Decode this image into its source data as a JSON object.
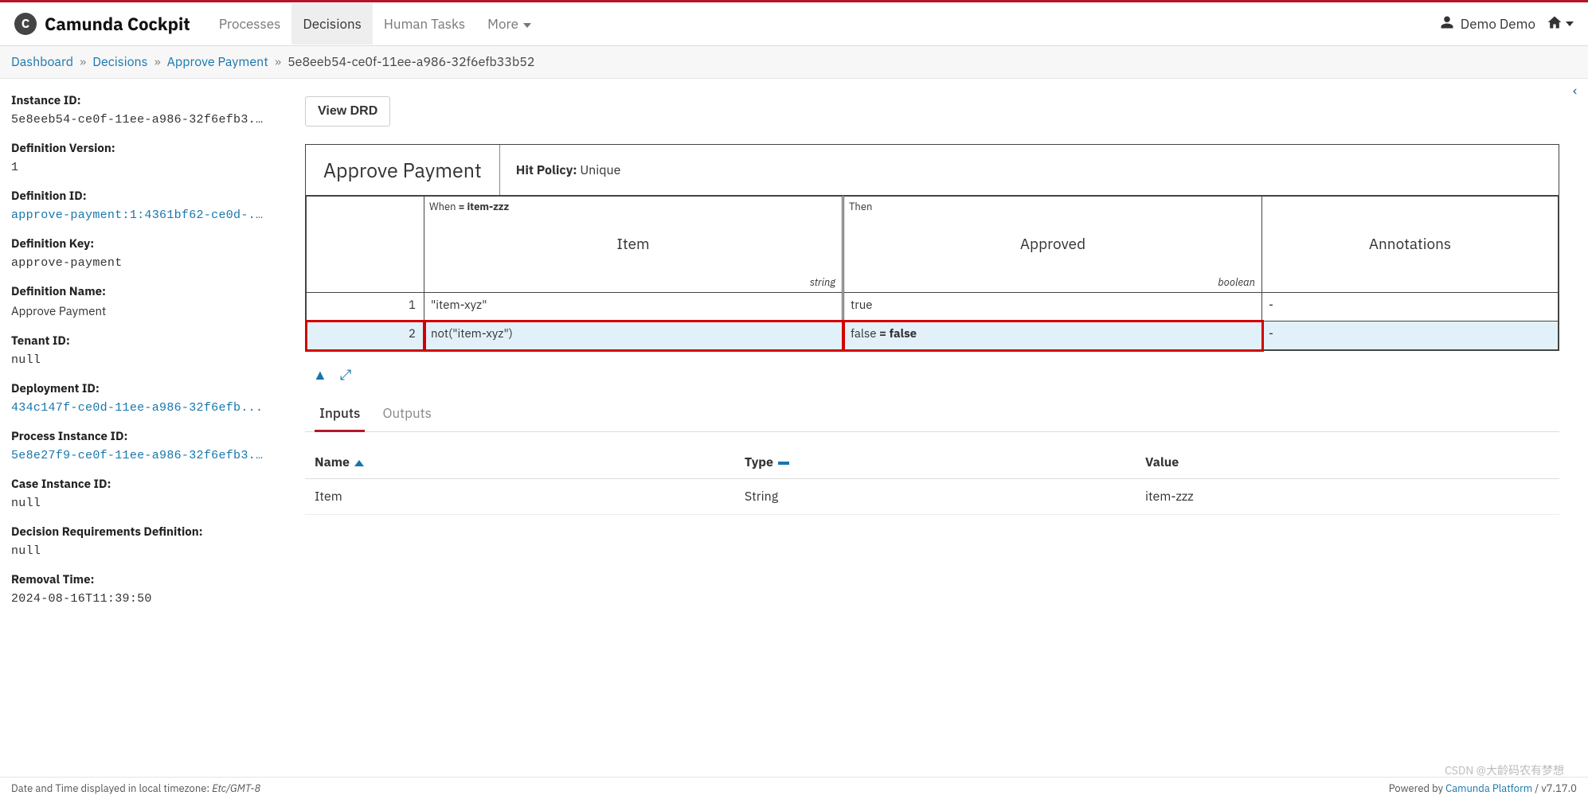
{
  "brand": "Camunda Cockpit",
  "nav": {
    "items": [
      "Processes",
      "Decisions",
      "Human Tasks",
      "More"
    ],
    "active": 1
  },
  "user": "Demo Demo",
  "breadcrumb": {
    "items": [
      "Dashboard",
      "Decisions",
      "Approve Payment"
    ],
    "current": "5e8eeb54-ce0f-11ee-a986-32f6efb33b52"
  },
  "sidebar": {
    "instance_id": {
      "label": "Instance ID:",
      "value": "5e8eeb54-ce0f-11ee-a986-32f6efb3..."
    },
    "def_version": {
      "label": "Definition Version:",
      "value": "1"
    },
    "def_id": {
      "label": "Definition ID:",
      "value": "approve-payment:1:4361bf62-ce0d-..."
    },
    "def_key": {
      "label": "Definition Key:",
      "value": "approve-payment"
    },
    "def_name": {
      "label": "Definition Name:",
      "value": "Approve Payment"
    },
    "tenant_id": {
      "label": "Tenant ID:",
      "value": "null"
    },
    "deploy_id": {
      "label": "Deployment ID:",
      "value": "434c147f-ce0d-11ee-a986-32f6efb..."
    },
    "proc_inst": {
      "label": "Process Instance ID:",
      "value": "5e8e27f9-ce0f-11ee-a986-32f6efb3..."
    },
    "case_inst": {
      "label": "Case Instance ID:",
      "value": "null"
    },
    "drd": {
      "label": "Decision Requirements Definition:",
      "value": "null"
    },
    "removal": {
      "label": "Removal Time:",
      "value": "2024-08-16T11:39:50"
    }
  },
  "buttons": {
    "view_drd": "View DRD"
  },
  "dmn": {
    "title": "Approve Payment",
    "hit_policy_label": "Hit Policy:",
    "hit_policy": "Unique",
    "when_label": "When",
    "when_expr": "= item-zzz",
    "then_label": "Then",
    "input_name": "Item",
    "input_type": "string",
    "output_name": "Approved",
    "output_type": "boolean",
    "annotations": "Annotations",
    "rows": [
      {
        "idx": "1",
        "input": "\"item-xyz\"",
        "output": "true",
        "ann": "-",
        "hl": false
      },
      {
        "idx": "2",
        "input": "not(\"item-xyz\")",
        "output": "false = false",
        "ann": "-",
        "hl": true
      }
    ]
  },
  "tabs": {
    "items": [
      "Inputs",
      "Outputs"
    ],
    "active": 0
  },
  "io": {
    "headers": [
      "Name",
      "Type",
      "Value"
    ],
    "rows": [
      {
        "name": "Item",
        "type": "String",
        "value": "item-zzz"
      }
    ]
  },
  "footer": {
    "tz": "Date and Time displayed in local timezone: ",
    "tzval": "Etc/GMT-8",
    "powered": "Powered by ",
    "link": "Camunda Platform",
    "ver": " / v7.17.0"
  },
  "watermark": "CSDN @大龄码农有梦想"
}
